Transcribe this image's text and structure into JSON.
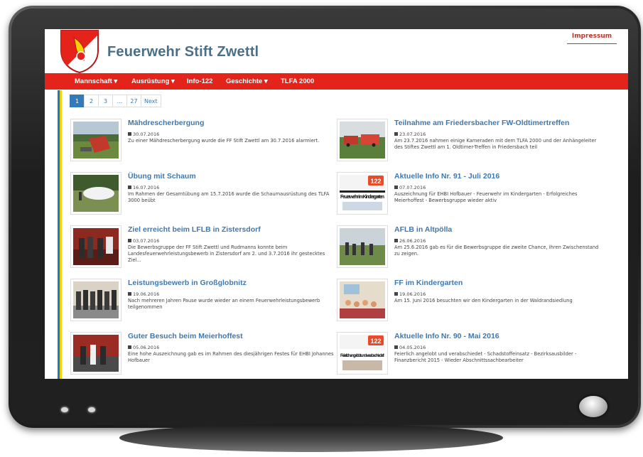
{
  "header": {
    "site_title": "Feuerwehr Stift Zwettl",
    "impressum_link": "Impressum"
  },
  "nav": {
    "items": [
      {
        "label": "Mannschaft ▾"
      },
      {
        "label": "Ausrüstung ▾"
      },
      {
        "label": "Info-122"
      },
      {
        "label": "Geschichte ▾"
      },
      {
        "label": "TLFA 2000"
      }
    ]
  },
  "pagination": {
    "pages": [
      "1",
      "2",
      "3",
      "...",
      "27"
    ],
    "current": "1",
    "next_label": "Next"
  },
  "articles": [
    {
      "title": "Mähdrescherbergung",
      "date": "30.07.2016",
      "text": "Zu einer Mähdrescherbergung wurde die FF Stift Zwettl am 30.7.2016 alarmiert."
    },
    {
      "title": "Teilnahme am Friedersbacher FW-Oldtimertreffen",
      "date": "23.07.2016",
      "text": "Am 23.7.2016 nahmen einige Kameraden mit dem TLFA 2000 und der Anhängeleiter des Stiftes Zwettl am 1. Oldtimer-Treffen in Friedersbach teil"
    },
    {
      "title": "Übung mit Schaum",
      "date": "16.07.2016",
      "text": "Im Rahmen der Gesamtübung am 15.7.2016 wurde die Schaumausrüstung des TLFA 3000 beübt"
    },
    {
      "title": "Aktuelle Info Nr. 91 - Juli 2016",
      "date": "07.07.2016",
      "text": "Auszeichnung für EHBI Hofbauer - Feuerwehr im Kindergarten - Erfolgreiches Meierhoffest - Bewerbsgruppe wieder aktiv"
    },
    {
      "title": "Ziel erreicht beim LFLB in Zistersdorf",
      "date": "03.07.2016",
      "text": "Die Bewerbsgruppe der FF Stift Zwettl und Rudmanns konnte beim Landesfeuerwehrleistungsbewerb in Zistersdorf am 2. und 3.7.2016 ihr gestecktes Ziel..."
    },
    {
      "title": "AFLB in Altpölla",
      "date": "26.06.2016",
      "text": "Am 25.6.2016 gab es für die Bewerbsgruppe die zweite Chance, ihren Zwischenstand zu zeigen."
    },
    {
      "title": "Leistungsbewerb in Großglobnitz",
      "date": "19.06.2016",
      "text": "Nach mehreren Jahren Pause wurde wieder an einem Feuerwehrleistungsbewerb teilgenommen"
    },
    {
      "title": "FF im Kindergarten",
      "date": "19.06.2016",
      "text": "Am 15. Juni 2016 besuchten wir den Kindergarten in der Waldrandsiedlung"
    },
    {
      "title": "Guter Besuch beim Meierhoffest",
      "date": "05.06.2016",
      "text": "Eine hohe Auszeichnung gab es im Rahmen des diesjährigen Festes für EHBI Johannes Hofbauer"
    },
    {
      "title": "Aktuelle Info Nr. 90 - Mai 2016",
      "date": "04.05.2016",
      "text": "Feierlich angelobt und verabschiedet - Schadstoffeinsatz - Bezirksausbilder - Finanzbericht 2015 - Wieder Abschnittssachbearbeiter"
    }
  ],
  "thumb_texts": {
    "info91_big": "Feuerwehr im Kindergarten",
    "info90_big": "Feierlich angelobt und verabschiedet!",
    "info_badge": "122"
  },
  "colors": {
    "navbar": "#e4231b",
    "title": "#4a6f86",
    "link": "#3f78b0",
    "accent_yellow": "#f2d300",
    "accent_blue": "#1d78c1"
  }
}
